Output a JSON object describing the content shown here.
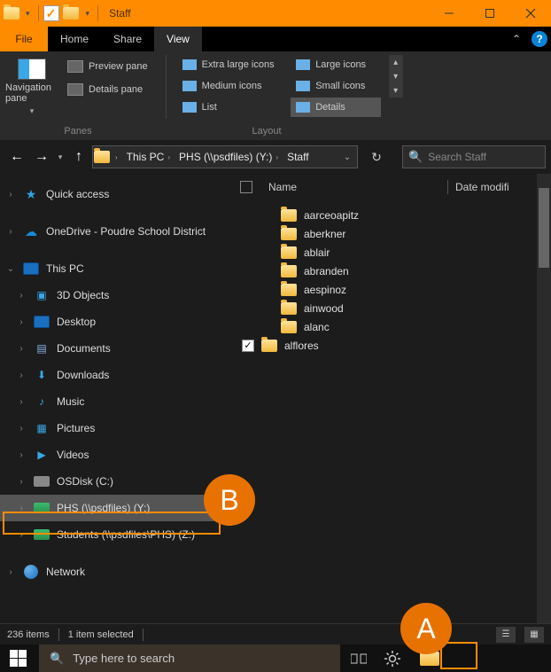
{
  "titlebar": {
    "title": "Staff"
  },
  "menubar": {
    "file": "File",
    "tabs": [
      "Home",
      "Share",
      "View"
    ],
    "active": "View"
  },
  "ribbon": {
    "navigation_label": "Navigation pane",
    "navigation_chev": "▾",
    "pane_options": [
      "Preview pane",
      "Details pane"
    ],
    "layout": [
      "Extra large icons",
      "Large icons",
      "Medium icons",
      "Small icons",
      "List",
      "Details"
    ],
    "group_panes": "Panes",
    "group_layout": "Layout"
  },
  "address": {
    "crumbs": [
      "This PC",
      "PHS (\\\\psdfiles) (Y:)",
      "Staff"
    ]
  },
  "search": {
    "placeholder": "Search Staff"
  },
  "columns": {
    "name": "Name",
    "date": "Date modifi"
  },
  "files": [
    "aarceoapitz",
    "aberkner",
    "ablair",
    "abranden",
    "aespinoz",
    "ainwood",
    "alanc",
    "alflores"
  ],
  "selected_file": "alflores",
  "tree": {
    "quick_access": "Quick access",
    "onedrive": "OneDrive - Poudre School District",
    "this_pc": "This PC",
    "this_pc_items": [
      "3D Objects",
      "Desktop",
      "Documents",
      "Downloads",
      "Music",
      "Pictures",
      "Videos",
      "OSDisk (C:)",
      "PHS (\\\\psdfiles) (Y:)",
      "Students (\\\\psdfiles\\PHS) (Z:)"
    ],
    "network": "Network"
  },
  "status": {
    "count": "236 items",
    "selected": "1 item selected"
  },
  "taskbar": {
    "search_placeholder": "Type here to search"
  },
  "annotations": {
    "A": "A",
    "B": "B"
  }
}
